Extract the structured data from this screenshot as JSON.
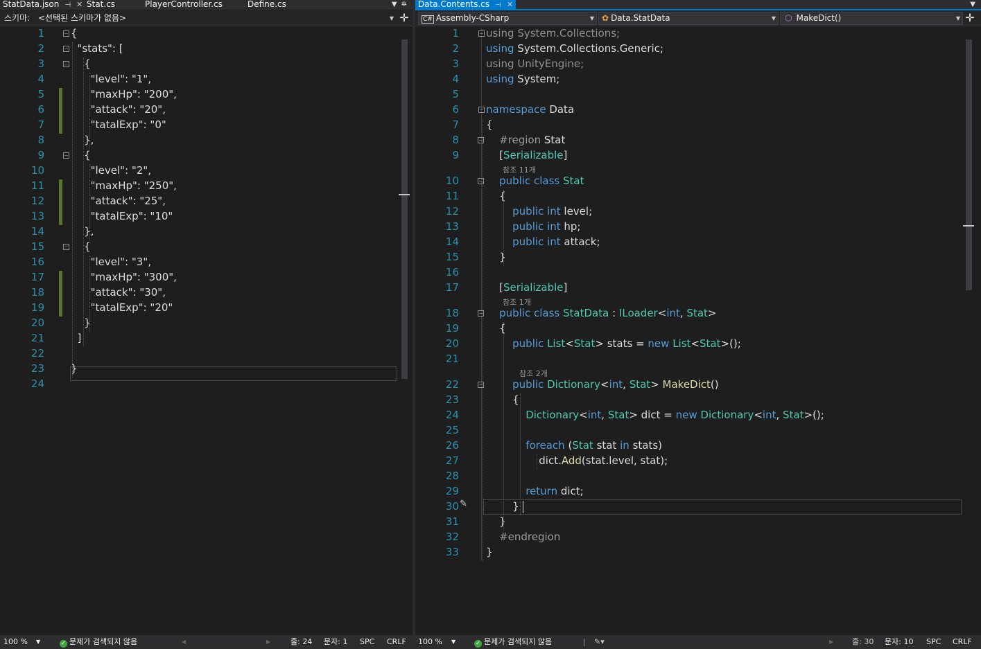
{
  "left_pane": {
    "tabs": [
      {
        "label": "StatData.json",
        "pin": "⊣",
        "close": "✕"
      },
      {
        "label": "Stat.cs"
      },
      {
        "label": "PlayerController.cs"
      },
      {
        "label": "Define.cs"
      }
    ],
    "schema_label": "스키마:",
    "schema_value": "<선택된 스키마가 없음>",
    "lines": [
      [
        {
          "c": "p",
          "t": "{"
        }
      ],
      [
        {
          "c": "p",
          "t": "  "
        },
        {
          "c": "p",
          "t": "\"stats\": ["
        }
      ],
      [
        {
          "c": "p",
          "t": "    {"
        }
      ],
      [
        {
          "c": "p",
          "t": "      \"level\": "
        },
        {
          "c": "p",
          "t": "\"1\","
        }
      ],
      [
        {
          "c": "p",
          "t": "      \"maxHp\": "
        },
        {
          "c": "p",
          "t": "\"200\","
        }
      ],
      [
        {
          "c": "p",
          "t": "      \"attack\": "
        },
        {
          "c": "p",
          "t": "\"20\","
        }
      ],
      [
        {
          "c": "p",
          "t": "      \"tatalExp\": "
        },
        {
          "c": "p",
          "t": "\"0\""
        }
      ],
      [
        {
          "c": "p",
          "t": "    },"
        }
      ],
      [
        {
          "c": "p",
          "t": "    {"
        }
      ],
      [
        {
          "c": "p",
          "t": "      \"level\": "
        },
        {
          "c": "p",
          "t": "\"2\","
        }
      ],
      [
        {
          "c": "p",
          "t": "      \"maxHp\": "
        },
        {
          "c": "p",
          "t": "\"250\","
        }
      ],
      [
        {
          "c": "p",
          "t": "      \"attack\": "
        },
        {
          "c": "p",
          "t": "\"25\","
        }
      ],
      [
        {
          "c": "p",
          "t": "      \"tatalExp\": "
        },
        {
          "c": "p",
          "t": "\"10\""
        }
      ],
      [
        {
          "c": "p",
          "t": "    },"
        }
      ],
      [
        {
          "c": "p",
          "t": "    {"
        }
      ],
      [
        {
          "c": "p",
          "t": "      \"level\": "
        },
        {
          "c": "p",
          "t": "\"3\","
        }
      ],
      [
        {
          "c": "p",
          "t": "      \"maxHp\": "
        },
        {
          "c": "p",
          "t": "\"300\","
        }
      ],
      [
        {
          "c": "p",
          "t": "      \"attack\": "
        },
        {
          "c": "p",
          "t": "\"30\","
        }
      ],
      [
        {
          "c": "p",
          "t": "      \"tatalExp\": "
        },
        {
          "c": "p",
          "t": "\"20\""
        }
      ],
      [
        {
          "c": "p",
          "t": "    }"
        }
      ],
      [
        {
          "c": "p",
          "t": "  ]"
        }
      ],
      [],
      [
        {
          "c": "p",
          "t": "}"
        }
      ],
      []
    ],
    "status": {
      "zoom": "100 %",
      "issues": "문제가 검색되지 않음",
      "line": "줄: 24",
      "col": "문자: 1",
      "spc": "SPC",
      "crlf": "CRLF"
    }
  },
  "right_pane": {
    "tabs": [
      {
        "label": "Data.Contents.cs",
        "pin": "⊣",
        "close": "✕"
      }
    ],
    "nav": {
      "project": "Assembly-CSharp",
      "type": "Data.StatData",
      "member": "MakeDict()"
    },
    "lines": [
      [
        {
          "c": "dim",
          "t": "using"
        },
        {
          "c": "p",
          "t": " "
        },
        {
          "c": "dim",
          "t": "System.Collections;"
        }
      ],
      [
        {
          "c": "kw",
          "t": "using"
        },
        {
          "c": "p",
          "t": " System.Collections.Generic;"
        }
      ],
      [
        {
          "c": "dim",
          "t": "using"
        },
        {
          "c": "p",
          "t": " "
        },
        {
          "c": "dim",
          "t": "UnityEngine;"
        }
      ],
      [
        {
          "c": "kw",
          "t": "using"
        },
        {
          "c": "p",
          "t": " System;"
        }
      ],
      [],
      [
        {
          "c": "kw",
          "t": "namespace"
        },
        {
          "c": "p",
          "t": " Data"
        }
      ],
      [
        {
          "c": "p",
          "t": "{"
        }
      ],
      [
        {
          "c": "p",
          "t": "    "
        },
        {
          "c": "rg",
          "t": "#region"
        },
        {
          "c": "p",
          "t": " Stat"
        }
      ],
      [
        {
          "c": "p",
          "t": "    ["
        },
        {
          "c": "ty",
          "t": "Serializable"
        },
        {
          "c": "p",
          "t": "]"
        }
      ],
      [
        {
          "c": "p",
          "t": "    "
        },
        {
          "c": "kw",
          "t": "public"
        },
        {
          "c": "p",
          "t": " "
        },
        {
          "c": "kw",
          "t": "class"
        },
        {
          "c": "p",
          "t": " "
        },
        {
          "c": "ty",
          "t": "Stat"
        }
      ],
      [
        {
          "c": "p",
          "t": "    {"
        }
      ],
      [
        {
          "c": "p",
          "t": "        "
        },
        {
          "c": "kw",
          "t": "public"
        },
        {
          "c": "p",
          "t": " "
        },
        {
          "c": "kw",
          "t": "int"
        },
        {
          "c": "p",
          "t": " level;"
        }
      ],
      [
        {
          "c": "p",
          "t": "        "
        },
        {
          "c": "kw",
          "t": "public"
        },
        {
          "c": "p",
          "t": " "
        },
        {
          "c": "kw",
          "t": "int"
        },
        {
          "c": "p",
          "t": " hp;"
        }
      ],
      [
        {
          "c": "p",
          "t": "        "
        },
        {
          "c": "kw",
          "t": "public"
        },
        {
          "c": "p",
          "t": " "
        },
        {
          "c": "kw",
          "t": "int"
        },
        {
          "c": "p",
          "t": " attack;"
        }
      ],
      [
        {
          "c": "p",
          "t": "    }"
        }
      ],
      [],
      [
        {
          "c": "p",
          "t": "    ["
        },
        {
          "c": "ty",
          "t": "Serializable"
        },
        {
          "c": "p",
          "t": "]"
        }
      ],
      [
        {
          "c": "p",
          "t": "    "
        },
        {
          "c": "kw",
          "t": "public"
        },
        {
          "c": "p",
          "t": " "
        },
        {
          "c": "kw",
          "t": "class"
        },
        {
          "c": "p",
          "t": " "
        },
        {
          "c": "ty",
          "t": "StatData"
        },
        {
          "c": "p",
          "t": " : "
        },
        {
          "c": "ty",
          "t": "ILoader"
        },
        {
          "c": "p",
          "t": "<"
        },
        {
          "c": "kw",
          "t": "int"
        },
        {
          "c": "p",
          "t": ", "
        },
        {
          "c": "ty",
          "t": "Stat"
        },
        {
          "c": "p",
          "t": ">"
        }
      ],
      [
        {
          "c": "p",
          "t": "    {"
        }
      ],
      [
        {
          "c": "p",
          "t": "        "
        },
        {
          "c": "kw",
          "t": "public"
        },
        {
          "c": "p",
          "t": " "
        },
        {
          "c": "ty",
          "t": "List"
        },
        {
          "c": "p",
          "t": "<"
        },
        {
          "c": "ty",
          "t": "Stat"
        },
        {
          "c": "p",
          "t": "> stats = "
        },
        {
          "c": "kw",
          "t": "new"
        },
        {
          "c": "p",
          "t": " "
        },
        {
          "c": "ty",
          "t": "List"
        },
        {
          "c": "p",
          "t": "<"
        },
        {
          "c": "ty",
          "t": "Stat"
        },
        {
          "c": "p",
          "t": ">();"
        }
      ],
      [],
      [
        {
          "c": "p",
          "t": "        "
        },
        {
          "c": "kw",
          "t": "public"
        },
        {
          "c": "p",
          "t": " "
        },
        {
          "c": "ty",
          "t": "Dictionary"
        },
        {
          "c": "p",
          "t": "<"
        },
        {
          "c": "kw",
          "t": "int"
        },
        {
          "c": "p",
          "t": ", "
        },
        {
          "c": "ty",
          "t": "Stat"
        },
        {
          "c": "p",
          "t": "> "
        },
        {
          "c": "fn",
          "t": "MakeDict"
        },
        {
          "c": "p",
          "t": "()"
        }
      ],
      [
        {
          "c": "p",
          "t": "        {"
        }
      ],
      [
        {
          "c": "p",
          "t": "            "
        },
        {
          "c": "ty",
          "t": "Dictionary"
        },
        {
          "c": "p",
          "t": "<"
        },
        {
          "c": "kw",
          "t": "int"
        },
        {
          "c": "p",
          "t": ", "
        },
        {
          "c": "ty",
          "t": "Stat"
        },
        {
          "c": "p",
          "t": "> dict = "
        },
        {
          "c": "kw",
          "t": "new"
        },
        {
          "c": "p",
          "t": " "
        },
        {
          "c": "ty",
          "t": "Dictionary"
        },
        {
          "c": "p",
          "t": "<"
        },
        {
          "c": "kw",
          "t": "int"
        },
        {
          "c": "p",
          "t": ", "
        },
        {
          "c": "ty",
          "t": "Stat"
        },
        {
          "c": "p",
          "t": ">();"
        }
      ],
      [],
      [
        {
          "c": "p",
          "t": "            "
        },
        {
          "c": "kw",
          "t": "foreach"
        },
        {
          "c": "p",
          "t": " ("
        },
        {
          "c": "ty",
          "t": "Stat"
        },
        {
          "c": "p",
          "t": " stat "
        },
        {
          "c": "kw",
          "t": "in"
        },
        {
          "c": "p",
          "t": " stats)"
        }
      ],
      [
        {
          "c": "p",
          "t": "                dict."
        },
        {
          "c": "fn",
          "t": "Add"
        },
        {
          "c": "p",
          "t": "(stat.level, stat);"
        }
      ],
      [],
      [
        {
          "c": "p",
          "t": "            "
        },
        {
          "c": "kw",
          "t": "return"
        },
        {
          "c": "p",
          "t": " dict;"
        }
      ],
      [
        {
          "c": "p",
          "t": "        }"
        }
      ],
      [
        {
          "c": "p",
          "t": "    }"
        }
      ],
      [
        {
          "c": "p",
          "t": "    "
        },
        {
          "c": "rg",
          "t": "#endregion"
        }
      ],
      [
        {
          "c": "p",
          "t": "}"
        }
      ]
    ],
    "ref_hints": [
      {
        "after_line": 9,
        "text": "참조 11개"
      },
      {
        "after_line": 17,
        "text": "참조 1개"
      },
      {
        "after_line": 21,
        "text": "참조 2개"
      }
    ],
    "status": {
      "zoom": "100 %",
      "issues": "문제가 검색되지 않음",
      "line": "줄: 30",
      "col": "문자: 10",
      "spc": "SPC",
      "crlf": "CRLF"
    }
  },
  "colors": {
    "accent": "#007acc",
    "keyword": "#569cd6",
    "type": "#4ec9b0",
    "change_bar": "#577430"
  }
}
